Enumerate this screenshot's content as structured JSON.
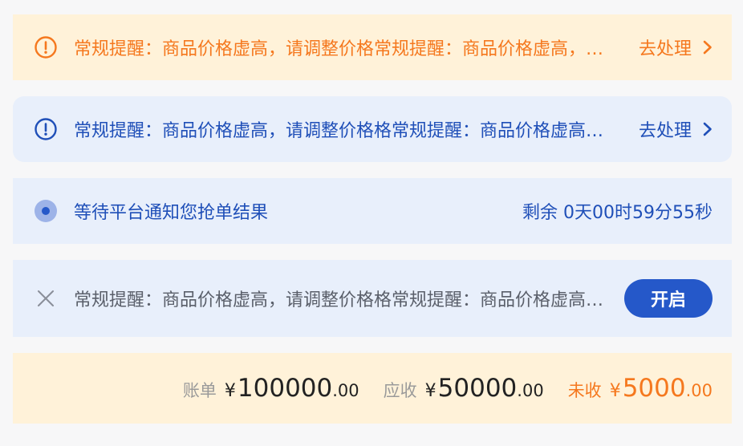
{
  "alerts": {
    "orange": {
      "message": "常规提醒：商品价格虚高，请调整价格常规提醒：商品价格虚高，请调整价格",
      "action": "去处理"
    },
    "blue": {
      "message": "常规提醒：商品价格虚高，请调整价格格常规提醒：商品价格虚高，请调整价格",
      "action": "去处理"
    }
  },
  "waiting": {
    "message": "等待平台通知您抢单结果",
    "countdown": "剩余 0天00时59分55秒"
  },
  "notice": {
    "message": "常规提醒：商品价格虚高，请调整价格格常规提醒：商品价格虚高，请调整价格",
    "button": "开启"
  },
  "summary": {
    "bill": {
      "label": "账单",
      "currency": "¥",
      "integer": "100000",
      "decimal": ".00"
    },
    "receivable": {
      "label": "应收",
      "currency": "¥",
      "integer": "50000",
      "decimal": ".00"
    },
    "unreceived": {
      "label": "未收",
      "currency": "¥",
      "integer": "5000",
      "decimal": ".00"
    }
  },
  "colors": {
    "orange": "#f5781e",
    "blue": "#1f4fb8",
    "orange_bg": "#fff2d9",
    "blue_bg": "#e8effb",
    "button": "#2558c9"
  },
  "icons": {
    "orange_alert": "exclamation-circle-icon",
    "blue_alert": "exclamation-circle-icon",
    "waiting": "radio-dot-icon",
    "notice": "close-icon",
    "action": "chevron-right-icon"
  }
}
